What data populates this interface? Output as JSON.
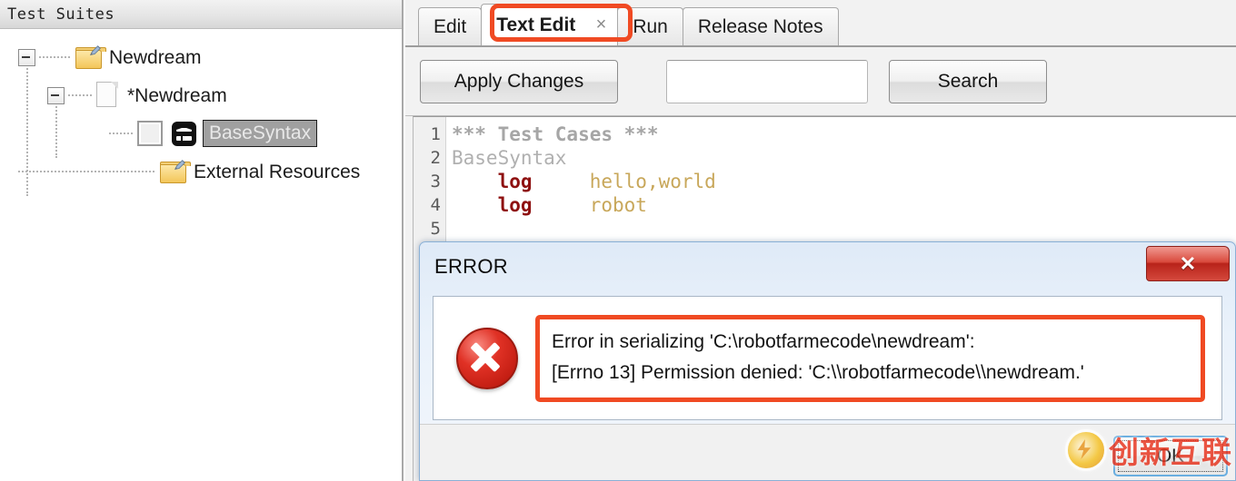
{
  "left_panel": {
    "header_title": "Test Suites",
    "tree": [
      {
        "label": "Newdream",
        "icon": "folder-icon",
        "expander": "collapse-minus",
        "level": 1,
        "selected": false
      },
      {
        "label": "*Newdream",
        "icon": "document-icon",
        "expander": "collapse-minus",
        "level": 2,
        "selected": false
      },
      {
        "label": "BaseSyntax",
        "icon": "robot-icon",
        "checkbox": "unchecked",
        "level": 3,
        "selected": true
      },
      {
        "label": "External Resources",
        "icon": "folder-icon",
        "level": 1,
        "selected": false
      }
    ]
  },
  "tabs": [
    {
      "label": "Edit",
      "active": false,
      "closable": false
    },
    {
      "label": "Text Edit",
      "active": true,
      "closable": true,
      "close_glyph": "×",
      "highlight_color": "#f04a23"
    },
    {
      "label": "Run",
      "active": false,
      "closable": false
    },
    {
      "label": "Release Notes",
      "active": false,
      "closable": false
    }
  ],
  "toolbar": {
    "apply_changes_label": "Apply Changes",
    "search_label": "Search",
    "search_value": "",
    "search_placeholder": ""
  },
  "editor": {
    "line_numbers": [
      "1",
      "2",
      "3",
      "4",
      "5"
    ],
    "lines": [
      {
        "n": "1",
        "tokens": [
          {
            "t": "*** Test Cases ***",
            "c": "tok-head"
          }
        ]
      },
      {
        "n": "2",
        "tokens": [
          {
            "t": "BaseSyntax",
            "c": "tok-name"
          }
        ]
      },
      {
        "n": "3",
        "tokens": [
          {
            "t": "    ",
            "c": ""
          },
          {
            "t": "log",
            "c": "tok-kw"
          },
          {
            "t": "     ",
            "c": ""
          },
          {
            "t": "hello,world",
            "c": "tok-arg"
          }
        ]
      },
      {
        "n": "4",
        "tokens": [
          {
            "t": "    ",
            "c": ""
          },
          {
            "t": "log",
            "c": "tok-kw"
          },
          {
            "t": "     ",
            "c": ""
          },
          {
            "t": "robot",
            "c": "tok-arg"
          }
        ]
      },
      {
        "n": "5",
        "tokens": [
          {
            "t": "",
            "c": ""
          }
        ]
      }
    ],
    "text": "*** Test Cases ***\nBaseSyntax\n    log     hello,world\n    log     robot\n"
  },
  "error_dialog": {
    "title": "ERROR",
    "close_glyph": "✕",
    "icon": "error-x-circle-icon",
    "message_line1": "Error in serializing 'C:\\robotfarmecode\\newdream':",
    "message_line2": "[Errno 13] Permission denied: 'C:\\\\robotfarmecode\\\\newdream.'",
    "ok_label": "OK",
    "highlight_color": "#f04a23"
  },
  "watermark": {
    "text": "创新互联",
    "color": "#e8321c"
  }
}
